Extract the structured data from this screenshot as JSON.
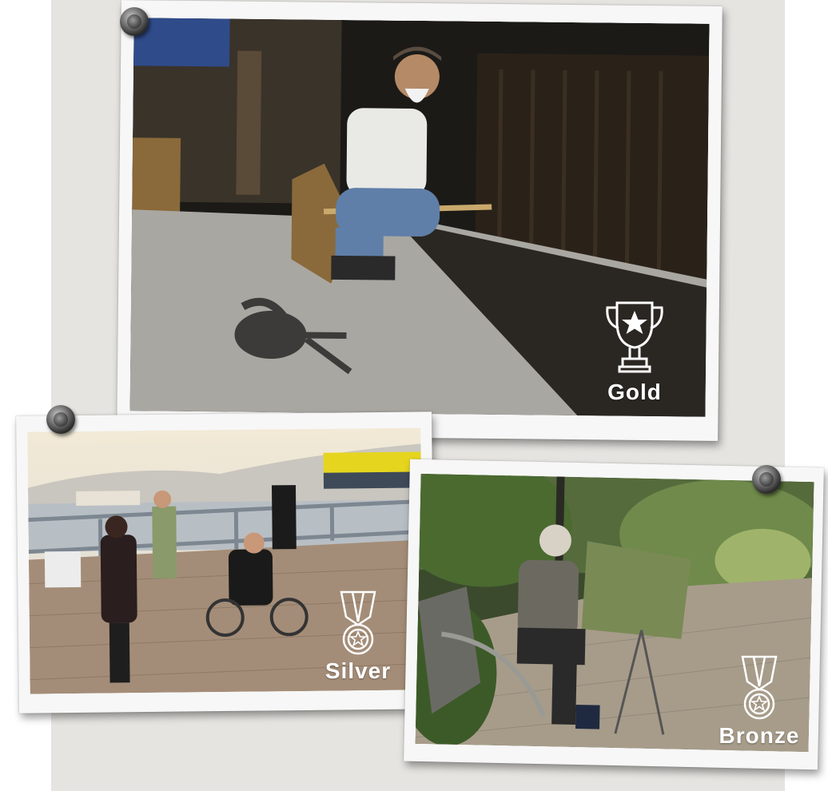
{
  "awards": [
    {
      "label": "Gold",
      "icon": "trophy-star-icon"
    },
    {
      "label": "Silver",
      "icon": "medal-icon"
    },
    {
      "label": "Bronze",
      "icon": "medal-icon"
    }
  ],
  "colors": {
    "board": "#e6e4e0",
    "frame": "#f7f7f7",
    "label": "#ffffff"
  }
}
